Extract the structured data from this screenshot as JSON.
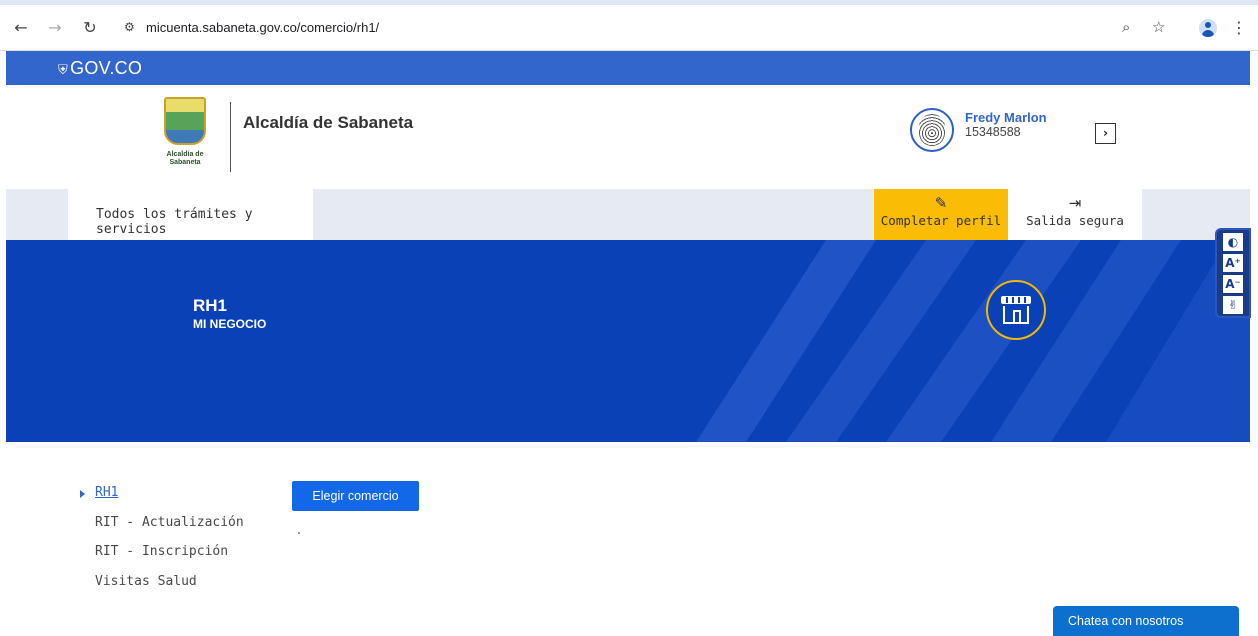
{
  "browser": {
    "url": "micuenta.sabaneta.gov.co/comercio/rh1/"
  },
  "govbar": {
    "logo": "GOV.CO"
  },
  "header": {
    "org_name": "Alcaldía de Sabaneta",
    "emblem_text": "Alcaldía de Sabaneta",
    "user_name": "Fredy Marlon",
    "user_id": "15348588",
    "arrow": "›"
  },
  "menu": {
    "all_services": "Todos los trámites y servicios",
    "complete_profile": "Completar perfil",
    "safe_exit": "Salida segura"
  },
  "banner": {
    "title": "RH1",
    "subtitle": "MI NEGOCIO"
  },
  "a11y": {
    "contrast": "◐",
    "increase": "A⁺",
    "decrease": "A⁻",
    "sign": "✌"
  },
  "leftnav": {
    "items": [
      "RH1",
      "RIT - Actualización",
      "RIT - Inscripción",
      "Visitas Salud"
    ]
  },
  "main": {
    "choose_button": "Elegir comercio"
  },
  "chat": {
    "label": "Chatea con nosotros"
  },
  "colors": {
    "gov_blue": "#3366cc",
    "banner_blue": "#0a41b7",
    "accent_yellow": "#fbbc05",
    "button_blue": "#1268e7"
  }
}
